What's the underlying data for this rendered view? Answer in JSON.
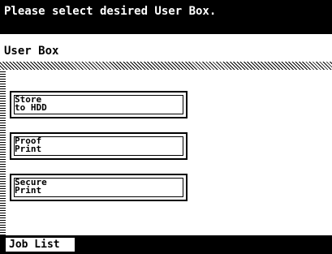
{
  "header": {
    "message": "Please select desired User Box."
  },
  "title": {
    "label": "User Box"
  },
  "buttons": [
    {
      "label": "Store\nto HDD"
    },
    {
      "label": "Proof\nPrint"
    },
    {
      "label": "Secure\nPrint"
    }
  ],
  "footer": {
    "tab_label": "Job List"
  }
}
